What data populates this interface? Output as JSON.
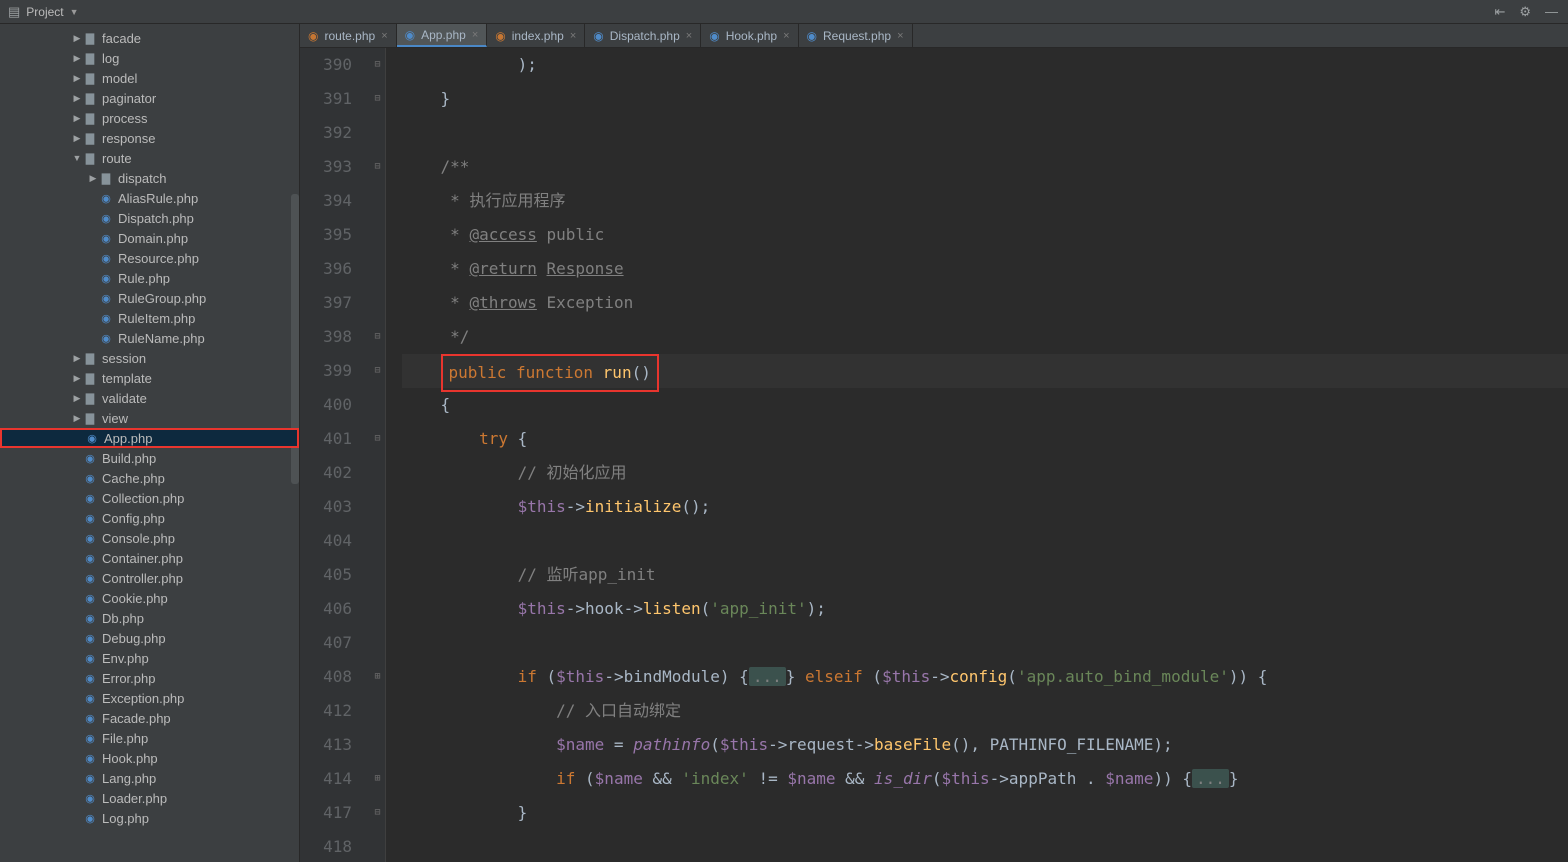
{
  "topbar": {
    "project_label": "Project"
  },
  "tree": [
    {
      "indent": 1,
      "type": "fld",
      "tw": "▶",
      "label": "facade"
    },
    {
      "indent": 1,
      "type": "fld",
      "tw": "▶",
      "label": "log"
    },
    {
      "indent": 1,
      "type": "fld",
      "tw": "▶",
      "label": "model"
    },
    {
      "indent": 1,
      "type": "fld",
      "tw": "▶",
      "label": "paginator"
    },
    {
      "indent": 1,
      "type": "fld",
      "tw": "▶",
      "label": "process"
    },
    {
      "indent": 1,
      "type": "fld",
      "tw": "▶",
      "label": "response"
    },
    {
      "indent": 1,
      "type": "fld",
      "tw": "▼",
      "label": "route"
    },
    {
      "indent": 2,
      "type": "fld",
      "tw": "▶",
      "label": "dispatch"
    },
    {
      "indent": 2,
      "type": "php",
      "tw": "",
      "label": "AliasRule.php"
    },
    {
      "indent": 2,
      "type": "php",
      "tw": "",
      "label": "Dispatch.php"
    },
    {
      "indent": 2,
      "type": "php",
      "tw": "",
      "label": "Domain.php"
    },
    {
      "indent": 2,
      "type": "php",
      "tw": "",
      "label": "Resource.php"
    },
    {
      "indent": 2,
      "type": "php",
      "tw": "",
      "label": "Rule.php"
    },
    {
      "indent": 2,
      "type": "php",
      "tw": "",
      "label": "RuleGroup.php"
    },
    {
      "indent": 2,
      "type": "php",
      "tw": "",
      "label": "RuleItem.php"
    },
    {
      "indent": 2,
      "type": "php",
      "tw": "",
      "label": "RuleName.php"
    },
    {
      "indent": 1,
      "type": "fld",
      "tw": "▶",
      "label": "session"
    },
    {
      "indent": 1,
      "type": "fld",
      "tw": "▶",
      "label": "template"
    },
    {
      "indent": 1,
      "type": "fld",
      "tw": "▶",
      "label": "validate"
    },
    {
      "indent": 1,
      "type": "fld",
      "tw": "▶",
      "label": "view"
    },
    {
      "indent": 1,
      "type": "php",
      "tw": "",
      "label": "App.php",
      "sel": true,
      "box": true
    },
    {
      "indent": 1,
      "type": "php",
      "tw": "",
      "label": "Build.php"
    },
    {
      "indent": 1,
      "type": "php",
      "tw": "",
      "label": "Cache.php"
    },
    {
      "indent": 1,
      "type": "php",
      "tw": "",
      "label": "Collection.php"
    },
    {
      "indent": 1,
      "type": "php",
      "tw": "",
      "label": "Config.php"
    },
    {
      "indent": 1,
      "type": "php",
      "tw": "",
      "label": "Console.php"
    },
    {
      "indent": 1,
      "type": "php",
      "tw": "",
      "label": "Container.php"
    },
    {
      "indent": 1,
      "type": "php",
      "tw": "",
      "label": "Controller.php"
    },
    {
      "indent": 1,
      "type": "php",
      "tw": "",
      "label": "Cookie.php"
    },
    {
      "indent": 1,
      "type": "php",
      "tw": "",
      "label": "Db.php"
    },
    {
      "indent": 1,
      "type": "php",
      "tw": "",
      "label": "Debug.php"
    },
    {
      "indent": 1,
      "type": "php",
      "tw": "",
      "label": "Env.php"
    },
    {
      "indent": 1,
      "type": "php",
      "tw": "",
      "label": "Error.php"
    },
    {
      "indent": 1,
      "type": "php",
      "tw": "",
      "label": "Exception.php"
    },
    {
      "indent": 1,
      "type": "php",
      "tw": "",
      "label": "Facade.php"
    },
    {
      "indent": 1,
      "type": "php",
      "tw": "",
      "label": "File.php"
    },
    {
      "indent": 1,
      "type": "php",
      "tw": "",
      "label": "Hook.php"
    },
    {
      "indent": 1,
      "type": "php",
      "tw": "",
      "label": "Lang.php"
    },
    {
      "indent": 1,
      "type": "php",
      "tw": "",
      "label": "Loader.php"
    },
    {
      "indent": 1,
      "type": "php",
      "tw": "",
      "label": "Log.php"
    }
  ],
  "tabs": [
    {
      "label": "route.php",
      "icon": "php2",
      "active": false
    },
    {
      "label": "App.php",
      "icon": "php",
      "active": true
    },
    {
      "label": "index.php",
      "icon": "php2",
      "active": false
    },
    {
      "label": "Dispatch.php",
      "icon": "php",
      "active": false
    },
    {
      "label": "Hook.php",
      "icon": "php",
      "active": false
    },
    {
      "label": "Request.php",
      "icon": "php",
      "active": false
    }
  ],
  "code": {
    "lines": [
      {
        "n": "390",
        "fold": "⊟",
        "seg": [
          {
            "t": "            ",
            "c": ""
          },
          {
            "t": ");",
            "c": "c-default"
          }
        ]
      },
      {
        "n": "391",
        "fold": "⊟",
        "seg": [
          {
            "t": "    ",
            "c": ""
          },
          {
            "t": "}",
            "c": "c-default"
          }
        ]
      },
      {
        "n": "392",
        "fold": "",
        "seg": []
      },
      {
        "n": "393",
        "fold": "⊟",
        "seg": [
          {
            "t": "    ",
            "c": ""
          },
          {
            "t": "/**",
            "c": "c-comment"
          }
        ]
      },
      {
        "n": "394",
        "fold": "",
        "seg": [
          {
            "t": "     ",
            "c": ""
          },
          {
            "t": "* 执行应用程序",
            "c": "c-comment"
          }
        ]
      },
      {
        "n": "395",
        "fold": "",
        "seg": [
          {
            "t": "     ",
            "c": ""
          },
          {
            "t": "* ",
            "c": "c-comment"
          },
          {
            "t": "@access",
            "c": "c-comment underline"
          },
          {
            "t": " public",
            "c": "c-comment"
          }
        ]
      },
      {
        "n": "396",
        "fold": "",
        "seg": [
          {
            "t": "     ",
            "c": ""
          },
          {
            "t": "* ",
            "c": "c-comment"
          },
          {
            "t": "@return",
            "c": "c-comment underline"
          },
          {
            "t": " ",
            "c": "c-comment"
          },
          {
            "t": "Response",
            "c": "c-comment underline"
          }
        ]
      },
      {
        "n": "397",
        "fold": "",
        "seg": [
          {
            "t": "     ",
            "c": ""
          },
          {
            "t": "* ",
            "c": "c-comment"
          },
          {
            "t": "@throws",
            "c": "c-comment underline"
          },
          {
            "t": " Exception",
            "c": "c-comment"
          }
        ]
      },
      {
        "n": "398",
        "fold": "⊟",
        "seg": [
          {
            "t": "     ",
            "c": ""
          },
          {
            "t": "*/",
            "c": "c-comment"
          }
        ]
      },
      {
        "n": "399",
        "fold": "⊟",
        "hl": true,
        "redbox": true,
        "seg": [
          {
            "t": "public ",
            "c": "c-keyword"
          },
          {
            "t": "function ",
            "c": "c-keyword"
          },
          {
            "t": "run",
            "c": "c-func"
          },
          {
            "t": "()",
            "c": "c-default"
          }
        ]
      },
      {
        "n": "400",
        "fold": "",
        "seg": [
          {
            "t": "    ",
            "c": ""
          },
          {
            "t": "{",
            "c": "c-default"
          }
        ]
      },
      {
        "n": "401",
        "fold": "⊟",
        "seg": [
          {
            "t": "        ",
            "c": ""
          },
          {
            "t": "try ",
            "c": "c-keyword"
          },
          {
            "t": "{",
            "c": "c-default"
          }
        ]
      },
      {
        "n": "402",
        "fold": "",
        "seg": [
          {
            "t": "            ",
            "c": ""
          },
          {
            "t": "// 初始化应用",
            "c": "c-comment"
          }
        ]
      },
      {
        "n": "403",
        "fold": "",
        "seg": [
          {
            "t": "            ",
            "c": ""
          },
          {
            "t": "$this",
            "c": "c-var"
          },
          {
            "t": "->",
            "c": "c-op"
          },
          {
            "t": "initialize",
            "c": "c-func"
          },
          {
            "t": "();",
            "c": "c-default"
          }
        ]
      },
      {
        "n": "404",
        "fold": "",
        "seg": []
      },
      {
        "n": "405",
        "fold": "",
        "seg": [
          {
            "t": "            ",
            "c": ""
          },
          {
            "t": "// 监听app_init",
            "c": "c-comment"
          }
        ]
      },
      {
        "n": "406",
        "fold": "",
        "seg": [
          {
            "t": "            ",
            "c": ""
          },
          {
            "t": "$this",
            "c": "c-var"
          },
          {
            "t": "->",
            "c": "c-op"
          },
          {
            "t": "hook",
            "c": "c-default"
          },
          {
            "t": "->",
            "c": "c-op"
          },
          {
            "t": "listen",
            "c": "c-func"
          },
          {
            "t": "(",
            "c": "c-default"
          },
          {
            "t": "'app_init'",
            "c": "c-string"
          },
          {
            "t": ");",
            "c": "c-default"
          }
        ]
      },
      {
        "n": "407",
        "fold": "",
        "seg": []
      },
      {
        "n": "408",
        "fold": "⊞",
        "seg": [
          {
            "t": "            ",
            "c": ""
          },
          {
            "t": "if ",
            "c": "c-keyword"
          },
          {
            "t": "(",
            "c": "c-default"
          },
          {
            "t": "$this",
            "c": "c-var"
          },
          {
            "t": "->",
            "c": "c-op"
          },
          {
            "t": "bindModule",
            "c": "c-default"
          },
          {
            "t": ") {",
            "c": "c-default"
          },
          {
            "t": "...",
            "c": "folded"
          },
          {
            "t": "} ",
            "c": "c-default"
          },
          {
            "t": "elseif ",
            "c": "c-keyword"
          },
          {
            "t": "(",
            "c": "c-default"
          },
          {
            "t": "$this",
            "c": "c-var"
          },
          {
            "t": "->",
            "c": "c-op"
          },
          {
            "t": "config",
            "c": "c-func"
          },
          {
            "t": "(",
            "c": "c-default"
          },
          {
            "t": "'app.auto_bind_module'",
            "c": "c-string"
          },
          {
            "t": ")) {",
            "c": "c-default"
          }
        ]
      },
      {
        "n": "412",
        "fold": "",
        "seg": [
          {
            "t": "                ",
            "c": ""
          },
          {
            "t": "// 入口自动绑定",
            "c": "c-comment"
          }
        ]
      },
      {
        "n": "413",
        "fold": "",
        "seg": [
          {
            "t": "                ",
            "c": ""
          },
          {
            "t": "$name",
            "c": "c-var"
          },
          {
            "t": " = ",
            "c": "c-op"
          },
          {
            "t": "pathinfo",
            "c": "c-italic"
          },
          {
            "t": "(",
            "c": "c-default"
          },
          {
            "t": "$this",
            "c": "c-var"
          },
          {
            "t": "->",
            "c": "c-op"
          },
          {
            "t": "request",
            "c": "c-default"
          },
          {
            "t": "->",
            "c": "c-op"
          },
          {
            "t": "baseFile",
            "c": "c-func"
          },
          {
            "t": "(), ",
            "c": "c-default"
          },
          {
            "t": "PATHINFO_FILENAME",
            "c": "c-default"
          },
          {
            "t": ");",
            "c": "c-default"
          }
        ]
      },
      {
        "n": "414",
        "fold": "⊞",
        "seg": [
          {
            "t": "                ",
            "c": ""
          },
          {
            "t": "if ",
            "c": "c-keyword"
          },
          {
            "t": "(",
            "c": "c-default"
          },
          {
            "t": "$name",
            "c": "c-var"
          },
          {
            "t": " && ",
            "c": "c-op"
          },
          {
            "t": "'index'",
            "c": "c-string"
          },
          {
            "t": " != ",
            "c": "c-op"
          },
          {
            "t": "$name",
            "c": "c-var"
          },
          {
            "t": " && ",
            "c": "c-op"
          },
          {
            "t": "is_dir",
            "c": "c-italic"
          },
          {
            "t": "(",
            "c": "c-default"
          },
          {
            "t": "$this",
            "c": "c-var"
          },
          {
            "t": "->",
            "c": "c-op"
          },
          {
            "t": "appPath",
            "c": "c-default"
          },
          {
            "t": " . ",
            "c": "c-op"
          },
          {
            "t": "$name",
            "c": "c-var"
          },
          {
            "t": ")) {",
            "c": "c-default"
          },
          {
            "t": "...",
            "c": "folded"
          },
          {
            "t": "}",
            "c": "c-default"
          }
        ]
      },
      {
        "n": "417",
        "fold": "⊟",
        "seg": [
          {
            "t": "            ",
            "c": ""
          },
          {
            "t": "}",
            "c": "c-default"
          }
        ]
      },
      {
        "n": "418",
        "fold": "",
        "seg": []
      }
    ]
  }
}
